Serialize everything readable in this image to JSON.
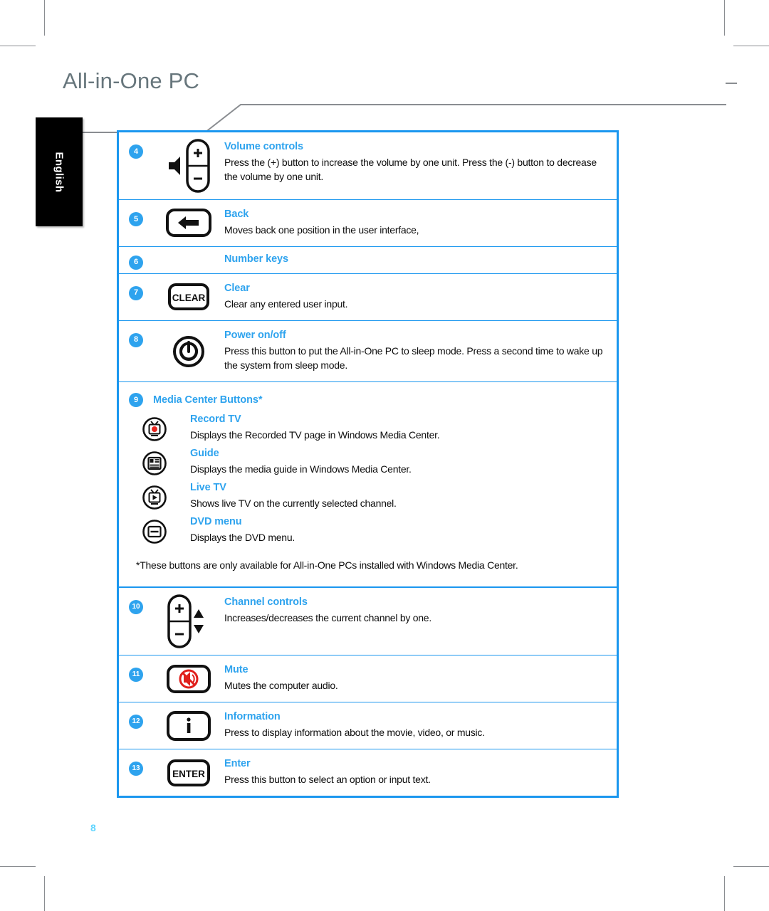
{
  "header": {
    "brand_title": "All-in-One PC"
  },
  "language_tab": {
    "label": "English"
  },
  "page": {
    "number": "8"
  },
  "colors": {
    "accent_blue": "#2ea3ee",
    "table_border": "#1b97ef",
    "title_gray": "#67767c",
    "page_number": "#5fd5ff",
    "record_red": "#e8251f",
    "mute_red": "#e0201c"
  },
  "table": {
    "rows": [
      {
        "number": "4",
        "icon": "volume-rocker-icon",
        "title": "Volume controls",
        "desc": "Press the (+) button to increase the volume by one unit. Press the (-) button to decrease the volume by one unit."
      },
      {
        "number": "5",
        "icon": "back-arrow-key-icon",
        "title": "Back",
        "desc": "Moves back one position in the user interface,"
      },
      {
        "number": "6",
        "icon": "none",
        "title": "Number keys",
        "desc": ""
      },
      {
        "number": "7",
        "icon": "clear-key-icon",
        "title": "Clear",
        "desc": "Clear any entered user input."
      },
      {
        "number": "8",
        "icon": "power-button-icon",
        "title": "Power on/off",
        "desc": "Press this button to put the All-in-One PC to sleep mode. Press a second time to wake up the system from sleep mode."
      }
    ],
    "media_center": {
      "number": "9",
      "heading": "Media Center Buttons*",
      "items": [
        {
          "icon": "record-tv-icon",
          "title": "Record TV",
          "desc": "Displays the Recorded TV page in Windows Media Center."
        },
        {
          "icon": "guide-icon",
          "title": "Guide",
          "desc": "Displays the media guide in Windows Media Center."
        },
        {
          "icon": "live-tv-icon",
          "title": "Live TV",
          "desc": "Shows live TV on the currently selected channel."
        },
        {
          "icon": "dvd-menu-icon",
          "title": "DVD menu",
          "desc": "Displays the DVD menu."
        }
      ],
      "footnote": "*These buttons are only available for All-in-One PCs installed with Windows Media Center."
    },
    "rows_bottom": [
      {
        "number": "10",
        "icon": "channel-rocker-icon",
        "title": "Channel controls",
        "desc": "Increases/decreases the current channel by one."
      },
      {
        "number": "11",
        "icon": "mute-key-icon",
        "title": "Mute",
        "desc": "Mutes the computer audio."
      },
      {
        "number": "12",
        "icon": "information-key-icon",
        "title": "Information",
        "desc": "Press to display information about the movie, video, or music."
      },
      {
        "number": "13",
        "icon": "enter-key-icon",
        "title": "Enter",
        "desc": "Press this button to select an option or input text."
      }
    ]
  },
  "icon_labels": {
    "clear_key": "CLEAR",
    "enter_key": "ENTER",
    "info_key": "i",
    "plus": "+",
    "minus": "−"
  }
}
